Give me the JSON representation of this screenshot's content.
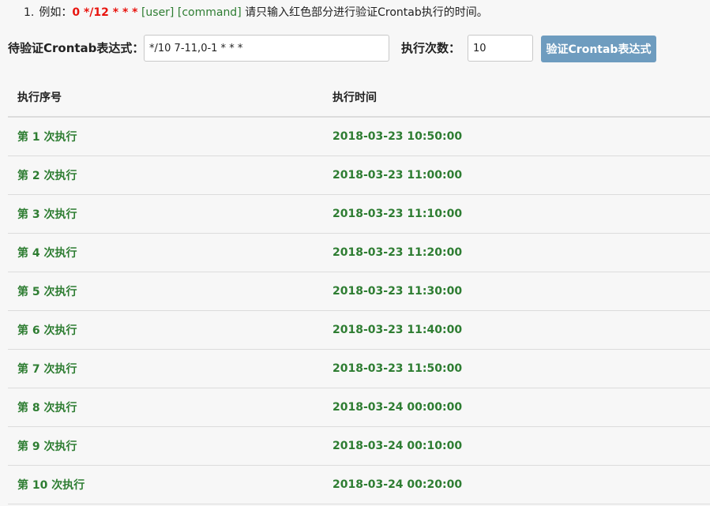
{
  "hint": {
    "number": "1.",
    "prefix": "例如：",
    "red_part": "0 */12 * * *",
    "user": "[user]",
    "command": "[command]",
    "suffix": "请只输入红色部分进行验证Crontab执行的时间。"
  },
  "form": {
    "expr_label": "待验证Crontab表达式：",
    "expr_value": "*/10 7-11,0-1 * * *",
    "count_label": "执行次数：",
    "count_value": "10",
    "submit_label": "验证Crontab表达式"
  },
  "table": {
    "columns": [
      "执行序号",
      "执行时间"
    ],
    "rows": [
      [
        "第 1 次执行",
        "2018-03-23 10:50:00"
      ],
      [
        "第 2 次执行",
        "2018-03-23 11:00:00"
      ],
      [
        "第 3 次执行",
        "2018-03-23 11:10:00"
      ],
      [
        "第 4 次执行",
        "2018-03-23 11:20:00"
      ],
      [
        "第 5 次执行",
        "2018-03-23 11:30:00"
      ],
      [
        "第 6 次执行",
        "2018-03-23 11:40:00"
      ],
      [
        "第 7 次执行",
        "2018-03-23 11:50:00"
      ],
      [
        "第 8 次执行",
        "2018-03-24 00:00:00"
      ],
      [
        "第 9 次执行",
        "2018-03-24 00:10:00"
      ],
      [
        "第 10 次执行",
        "2018-03-24 00:20:00"
      ]
    ]
  },
  "colors": {
    "red": "#e8140e",
    "green": "#2e7d32",
    "button": "#6e9cbf"
  }
}
